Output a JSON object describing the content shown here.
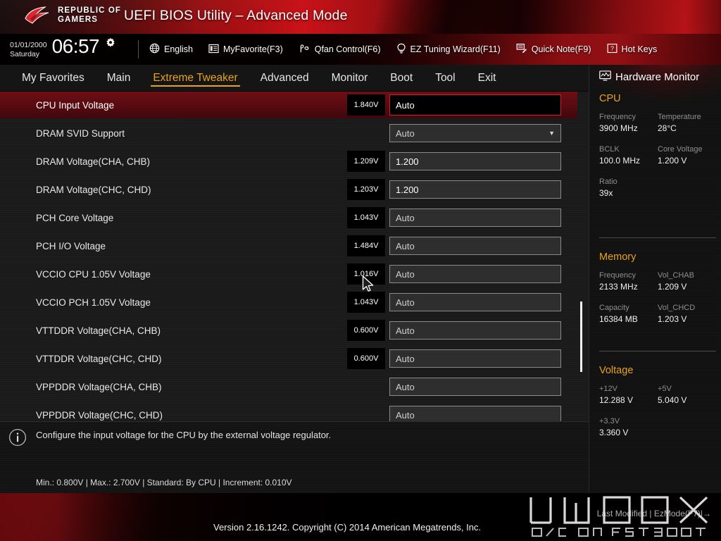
{
  "header": {
    "brand_line1": "REPUBLIC OF",
    "brand_line2": "GAMERS",
    "title": "UEFI BIOS Utility – Advanced Mode",
    "logo_icon": "rog-logo-icon"
  },
  "toolbar": {
    "date": "01/01/2000",
    "weekday": "Saturday",
    "time": "06:57",
    "gear_icon": "gear-icon",
    "items": [
      {
        "label": "English",
        "icon": "globe-icon"
      },
      {
        "label": "MyFavorite(F3)",
        "icon": "list-icon"
      },
      {
        "label": "Qfan Control(F6)",
        "icon": "fan-icon"
      },
      {
        "label": "EZ Tuning Wizard(F11)",
        "icon": "lightbulb-icon"
      },
      {
        "label": "Quick Note(F9)",
        "icon": "note-pencil-icon"
      },
      {
        "label": "Hot Keys",
        "icon": "question-box-icon"
      }
    ]
  },
  "nav": {
    "tabs": [
      {
        "label": "My Favorites",
        "active": false
      },
      {
        "label": "Main",
        "active": false
      },
      {
        "label": "Extreme Tweaker",
        "active": true
      },
      {
        "label": "Advanced",
        "active": false
      },
      {
        "label": "Monitor",
        "active": false
      },
      {
        "label": "Boot",
        "active": false
      },
      {
        "label": "Tool",
        "active": false
      },
      {
        "label": "Exit",
        "active": false
      }
    ],
    "active_color": "#e8a317"
  },
  "settings": {
    "rows": [
      {
        "label": "CPU Input Voltage",
        "measured": "1.840V",
        "value": "Auto",
        "type": "input",
        "selected": true,
        "bright": false
      },
      {
        "label": "DRAM SVID Support",
        "measured": "",
        "value": "Auto",
        "type": "dropdown",
        "selected": false,
        "bright": false
      },
      {
        "label": "DRAM Voltage(CHA, CHB)",
        "measured": "1.209V",
        "value": "1.200",
        "type": "input",
        "selected": false,
        "bright": true
      },
      {
        "label": "DRAM Voltage(CHC, CHD)",
        "measured": "1.203V",
        "value": "1.200",
        "type": "input",
        "selected": false,
        "bright": true
      },
      {
        "label": "PCH Core Voltage",
        "measured": "1.043V",
        "value": "Auto",
        "type": "input",
        "selected": false,
        "bright": false
      },
      {
        "label": "PCH I/O Voltage",
        "measured": "1.484V",
        "value": "Auto",
        "type": "input",
        "selected": false,
        "bright": false
      },
      {
        "label": "VCCIO CPU 1.05V Voltage",
        "measured": "1.016V",
        "value": "Auto",
        "type": "input",
        "selected": false,
        "bright": false
      },
      {
        "label": "VCCIO PCH 1.05V Voltage",
        "measured": "1.043V",
        "value": "Auto",
        "type": "input",
        "selected": false,
        "bright": false
      },
      {
        "label": "VTTDDR Voltage(CHA, CHB)",
        "measured": "0.600V",
        "value": "Auto",
        "type": "input",
        "selected": false,
        "bright": false
      },
      {
        "label": "VTTDDR Voltage(CHC, CHD)",
        "measured": "0.600V",
        "value": "Auto",
        "type": "input",
        "selected": false,
        "bright": false
      },
      {
        "label": "VPPDDR Voltage(CHA, CHB)",
        "measured": "",
        "value": "Auto",
        "type": "input",
        "selected": false,
        "bright": false
      },
      {
        "label": "VPPDDR Voltage(CHC, CHD)",
        "measured": "",
        "value": "Auto",
        "type": "input",
        "selected": false,
        "bright": false
      }
    ]
  },
  "hardware_monitor": {
    "title": "Hardware Monitor",
    "title_icon": "monitor-icon",
    "sections": [
      {
        "name": "CPU",
        "cells": [
          {
            "key": "Frequency",
            "value": "3900 MHz"
          },
          {
            "key": "Temperature",
            "value": "28°C"
          },
          {
            "key": "BCLK",
            "value": "100.0 MHz"
          },
          {
            "key": "Core Voltage",
            "value": "1.200 V"
          },
          {
            "key": "Ratio",
            "value": "39x"
          },
          {
            "key": "",
            "value": ""
          }
        ]
      },
      {
        "name": "Memory",
        "cells": [
          {
            "key": "Frequency",
            "value": "2133 MHz"
          },
          {
            "key": "Vol_CHAB",
            "value": "1.209 V"
          },
          {
            "key": "Capacity",
            "value": "16384 MB"
          },
          {
            "key": "Vol_CHCD",
            "value": "1.203 V"
          }
        ]
      },
      {
        "name": "Voltage",
        "cells": [
          {
            "key": "+12V",
            "value": "12.288 V"
          },
          {
            "key": "+5V",
            "value": "5.040 V"
          },
          {
            "key": "+3.3V",
            "value": "3.360 V"
          },
          {
            "key": "",
            "value": ""
          }
        ]
      }
    ],
    "section_color": "#e8a317"
  },
  "help": {
    "icon": "info-icon",
    "description": "Configure the input voltage for the CPU by the external voltage regulator.",
    "range": "Min.: 0.800V   |   Max.: 2.700V   |   Standard: By CPU   |   Increment: 0.010V"
  },
  "footer": {
    "version": "Version 2.16.1242. Copyright (C) 2014 American Megatrends, Inc.",
    "right_links": "Last Modified | EzMode(F7)|→",
    "watermark": "hwbox o/c on first boot"
  }
}
